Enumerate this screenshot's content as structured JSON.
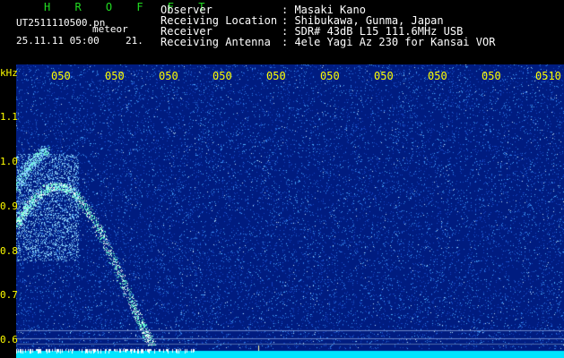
{
  "header": {
    "brand": "H R O F F T",
    "file_name": "UT2511110500.pn",
    "meteor_type": "meteor",
    "datetime": "25.11.11 05:00",
    "count": "21.",
    "meta": [
      {
        "key": "Observer",
        "value": ": Masaki Kano"
      },
      {
        "key": "Receiving Location",
        "value": ": Shibukawa, Gunma, Japan"
      },
      {
        "key": "Receiver",
        "value": ": SDR# 43dB L15 111.6MHz USB"
      },
      {
        "key": "Receiving Antenna",
        "value": ": 4ele Yagi Az 230 for Kansai VOR"
      }
    ]
  },
  "colors": {
    "brand": "#22dd22",
    "header_text": "#ffffff",
    "axis_text": "#ffff00",
    "background": "#001c80",
    "noise_light": "#4db0ff",
    "echo": "#66ffcc",
    "baseline": "#00e5ff"
  },
  "spectrogram": {
    "y_axis": {
      "unit": "kHz",
      "ticks": [
        "1.1",
        "1.0",
        "0.9",
        "0.8",
        "0.7",
        "0.6"
      ]
    },
    "x_axis": {
      "ticks": [
        "050",
        "050",
        "050",
        "050",
        "050",
        "050",
        "050",
        "050",
        "050",
        "050",
        "0510"
      ]
    }
  }
}
